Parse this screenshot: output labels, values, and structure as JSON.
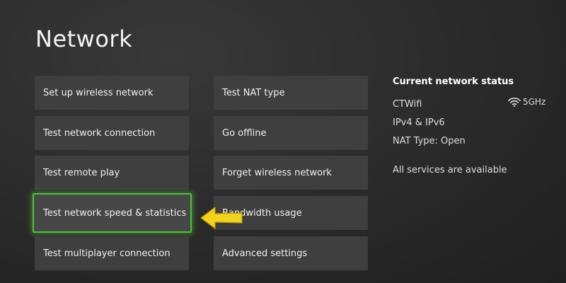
{
  "page": {
    "title": "Network"
  },
  "menu": {
    "column1": [
      {
        "label": "Set up wireless network"
      },
      {
        "label": "Test network connection"
      },
      {
        "label": "Test remote play"
      },
      {
        "label": "Test network speed & statistics",
        "selected": true
      },
      {
        "label": "Test multiplayer connection"
      }
    ],
    "column2": [
      {
        "label": "Test NAT type"
      },
      {
        "label": "Go offline"
      },
      {
        "label": "Forget wireless network"
      },
      {
        "label": "Bandwidth usage"
      },
      {
        "label": "Advanced settings"
      }
    ]
  },
  "status": {
    "heading": "Current network status",
    "network_name": "CTWifi",
    "band": "5GHz",
    "band_icon": "wifi-icon",
    "ip_version": "IPv4 & IPv6",
    "nat_type": "NAT Type: Open",
    "services": "All services are available"
  },
  "colors": {
    "selection_border": "#4cc23a",
    "pointer_arrow": "#f2d21b",
    "tile_background": "#3f3f3f"
  }
}
